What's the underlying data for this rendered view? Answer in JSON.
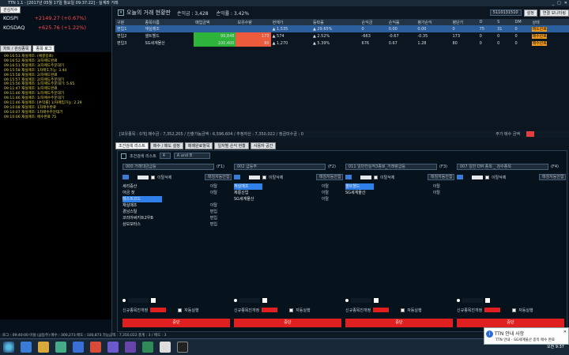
{
  "window": {
    "title": "TTN 1.1 - [2017년 05월 17일 월요일 09:37:22] - 실계좌 거래"
  },
  "left": {
    "tabs": [
      "관심지수",
      "차트 / 관심종목",
      "종목 로그"
    ],
    "indices": [
      {
        "name": "KOSPI",
        "value": "+2149.27 (+0.67%)"
      },
      {
        "name": "KOSDAQ",
        "value": "+625.76 (+1.22%)"
      }
    ],
    "log": [
      "09:16:53 재실매조: (채결중료)",
      "09:16:52 재실매조: 3/차매도완료",
      "09:16:51 재실매조: 3/차매도주문대기",
      "09:15:58 재실매조: 1차매도가능: 3.44",
      "09:15:58 재실매조: 2/차매도완료",
      "09:15:57 재실매조: 2/차매도주문대기",
      "09:15:56 재실매조: 1/차매도주문대기: 5.65",
      "09:11:47 재실매조: 1/차매도완료",
      "09:11:46 재실매조: 1/차매도주문대기",
      "09:11:46 재실매조: 1/차매수주문대기",
      "09:11:46 재실매조: [손익률] 1/차매입가능: 2.29",
      "09:10:08 재실매조: 1차매수완료",
      "09:10:07 재실매조: 1차매수주문대기",
      "09:10:06 재실매조: 매수완료 75"
    ]
  },
  "header": {
    "title": "오늘의 거래 현황판",
    "profit": "손익금 : 3,428",
    "rate": "손익률 : 3.42%",
    "account": "5110131510",
    "btn_settings": "설정",
    "btn_mode": "연결 모니터링"
  },
  "table": {
    "columns": [
      "구분",
      "종목이름",
      "매입금액",
      "보유수량",
      "현재가",
      "등락률",
      "손익금",
      "손익률",
      "평가손익",
      "평단가",
      "D",
      "S",
      "DM",
      "상태"
    ],
    "rows": [
      {
        "no": "편입1",
        "name": "재실매조",
        "buy": "",
        "qty": "",
        "price": "▲ 1,535",
        "rate": "▲ 29.65%",
        "pl": "0",
        "plr": "0.00",
        "eval": "0.00",
        "avg": "0",
        "d": "75",
        "s": "31",
        "dm": "0",
        "state": "매도완료",
        "sel": true
      },
      {
        "no": "편입2",
        "name": "셀트헬드",
        "buy": "99,848",
        "qty": "173",
        "price": "▲ 574",
        "rate": "▲ 2.52%",
        "pl": "-663",
        "plr": "-0.67",
        "eval": "-0.35",
        "avg": "173",
        "d": "0",
        "s": "0",
        "dm": "0",
        "state": "매수완료"
      },
      {
        "no": "편입3",
        "name": "SG세계물산",
        "buy": "100,400",
        "qty": "80",
        "price": "▲ 1,270",
        "rate": "▲ 5.39%",
        "pl": "676",
        "plr": "0.67",
        "eval": "1.28",
        "avg": "80",
        "d": "0",
        "s": "0",
        "dm": "0",
        "state": "매수완료"
      }
    ]
  },
  "statusbar": {
    "text": "[보유종목 : 0개]   매수금 : 7,352,205 / 인출가능금액 : 6,596,604 / 추정자산 : 7,350,022 / 정금미수금 : 0",
    "right": "주가 매수 금액"
  },
  "subtabs": [
    "조건검색 리스트",
    "매수 / 매도 설정",
    "매매완료항목",
    "일자별 손익 현황",
    "사용자 공간"
  ],
  "panel": {
    "top_label": "조건검색 리스트",
    "top_value": "4",
    "top_select": "A and B",
    "columns": [
      {
        "condition": "000 거래대금급등",
        "code": "(F1)",
        "toggle": "이탈삭제",
        "mode": "매칭자동안함",
        "items": [
          {
            "name": "세리증산",
            "state": "이탈"
          },
          {
            "name": "아금 첫",
            "state": "이탈"
          },
          {
            "name": "테스트코드",
            "state": "",
            "selected": true
          },
          {
            "name": "재실매조",
            "state": "이탈"
          },
          {
            "name": "경남스틸",
            "state": "편입"
          },
          {
            "name": "코리아써키트2우B",
            "state": "편입"
          },
          {
            "name": "상보모터스",
            "state": "편입"
          }
        ],
        "footer": "신규종목진개정",
        "stop": "중단",
        "auto": "자동실행"
      },
      {
        "condition": "002 급등주",
        "code": "(F2)",
        "toggle": "이탈삭제",
        "mode": "매칭자동안함",
        "items": [
          {
            "name": "재실매조",
            "state": "이탈",
            "selected": true
          },
          {
            "name": "제룡산업",
            "state": "이탈"
          },
          {
            "name": "SG세계물산",
            "state": "이탈"
          }
        ],
        "footer": "신규종목진개정",
        "stop": "중단",
        "auto": "자동실행"
      },
      {
        "condition": "011 일반전실적3종로_거래량급등",
        "code": "(F3)",
        "toggle": "이탈삭제",
        "mode": "매칭자동안함",
        "items": [
          {
            "name": "셀트헬드",
            "state": "이탈",
            "selected": true
          },
          {
            "name": "SG세계물산",
            "state": "이탈"
          }
        ],
        "footer": "신규종목진개정",
        "stop": "중단",
        "auto": "자동실행"
      },
      {
        "condition": "007 일반 DM 종목 _ 검수종목",
        "code": "(F4)",
        "toggle": "이탈삭제",
        "mode": "매칭자동안함",
        "items": [],
        "footer": "신규종목진개정",
        "stop": "중단",
        "auto": "자동실행"
      }
    ]
  },
  "bottom_status": "로그 : 09:40:00 이탈 (급등주)   매수 : 300,273  매도 : 100,873  가능금액 : 7,350,022   총계 : 3 / 매도 : 3",
  "popup": {
    "title": "TTN 안내 사항",
    "body": "TTN 안내 - SG세계물산 종목 매수 완료"
  },
  "clock": "오전 9:37"
}
